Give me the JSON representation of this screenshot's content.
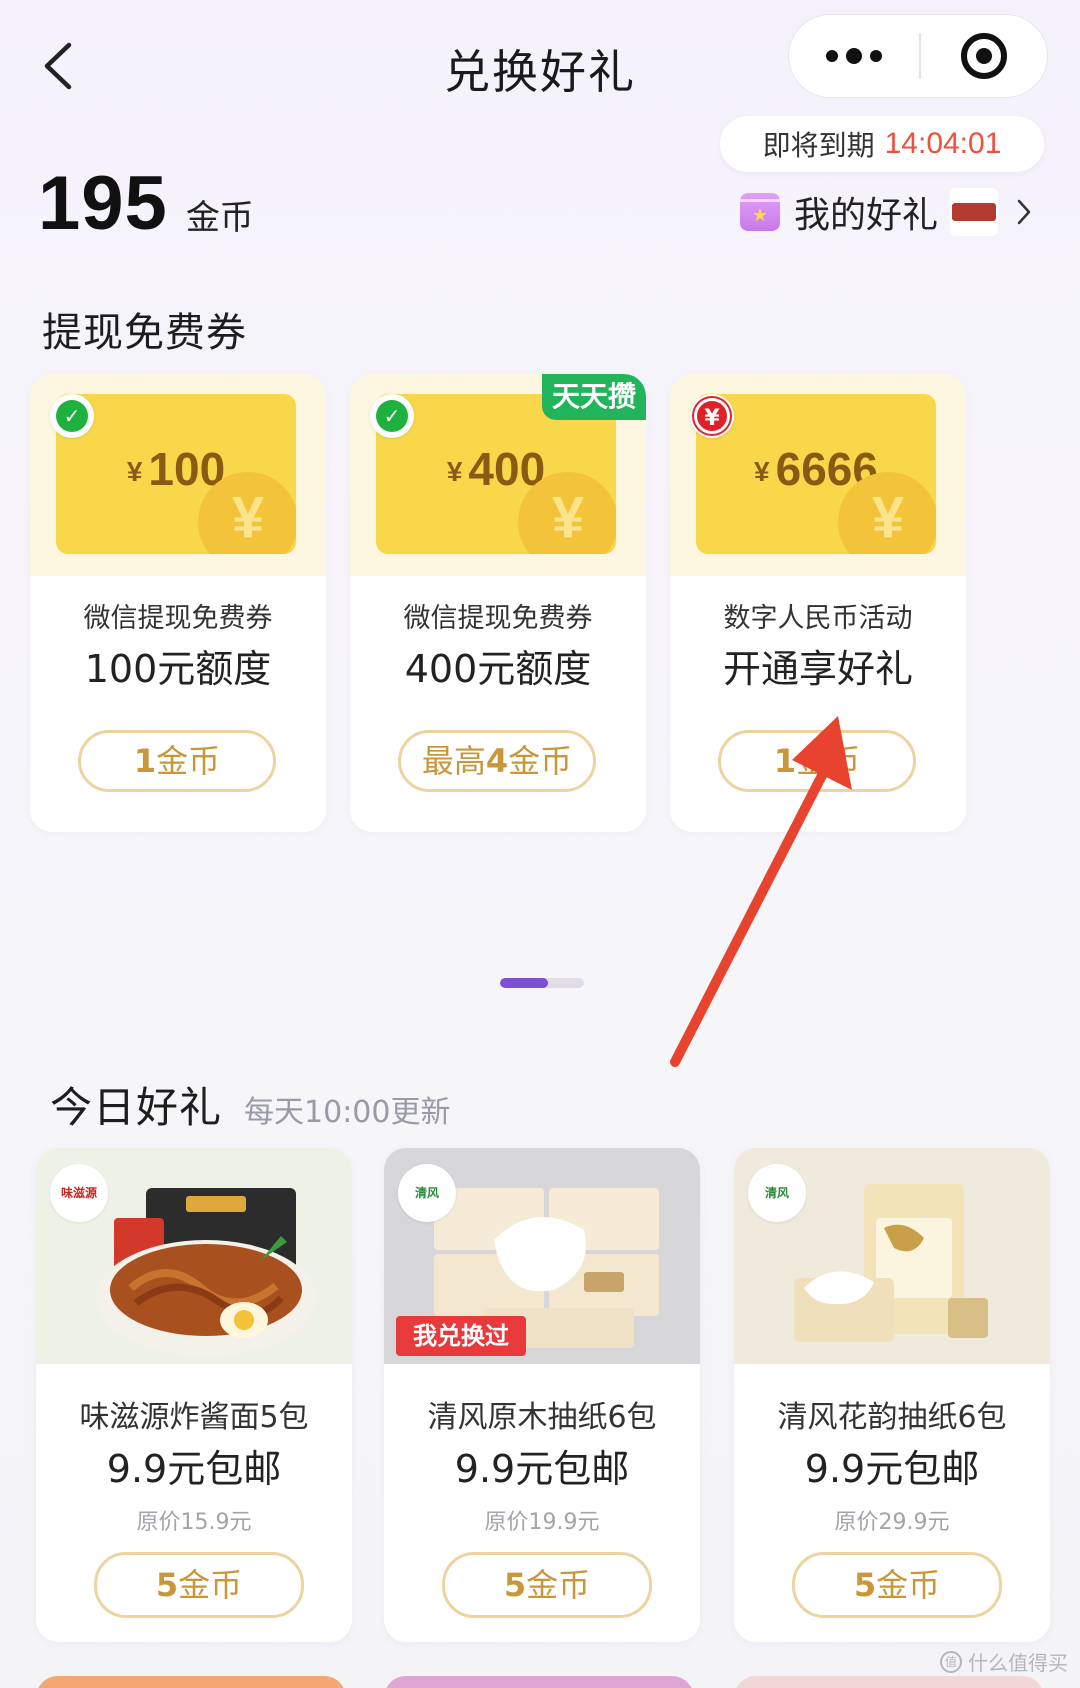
{
  "header": {
    "title": "兑换好礼"
  },
  "balance": {
    "amount": "195",
    "unit": "金币"
  },
  "expiry": {
    "label": "即将到期",
    "time": "14:04:01"
  },
  "my_gifts": {
    "label": "我的好礼"
  },
  "coupons": {
    "section_title": "提现免费券",
    "items": [
      {
        "currency": "¥",
        "amount": "100",
        "line1": "微信提现免费券",
        "line2": "100元额度",
        "button": "金币",
        "button_num": "1",
        "button_prefix": ""
      },
      {
        "currency": "¥",
        "amount": "400",
        "line1": "微信提现免费券",
        "line2": "400元额度",
        "button": "金币",
        "button_num": "4",
        "button_prefix": "最高",
        "tag": "天天攒"
      },
      {
        "currency": "¥",
        "amount": "6666",
        "line1": "数字人民币活动",
        "line2": "开通享好礼",
        "button": "金币",
        "button_num": "1",
        "button_prefix": ""
      }
    ]
  },
  "today": {
    "title": "今日好礼",
    "subtitle": "每天10:00更新",
    "items": [
      {
        "name": "味滋源炸酱面5包",
        "price": "9.9元包邮",
        "original": "原价15.9元",
        "button_num": "5",
        "button": "金币",
        "brand": "味滋源"
      },
      {
        "name": "清风原木抽纸6包",
        "price": "9.9元包邮",
        "original": "原价19.9元",
        "button_num": "5",
        "button": "金币",
        "brand": "清风",
        "tag": "我兑换过"
      },
      {
        "name": "清风花韵抽纸6包",
        "price": "9.9元包邮",
        "original": "原价29.9元",
        "button_num": "5",
        "button": "金币",
        "brand": "清风"
      }
    ]
  },
  "pager": {
    "pages": 2,
    "active": 1
  },
  "watermark": "什么值得买",
  "colors": {
    "accent": "#7b4fd6",
    "coin": "#c9963a",
    "ticket": "#f8d84a",
    "expiry_time": "#f0503c",
    "arrow": "#e8432e"
  }
}
